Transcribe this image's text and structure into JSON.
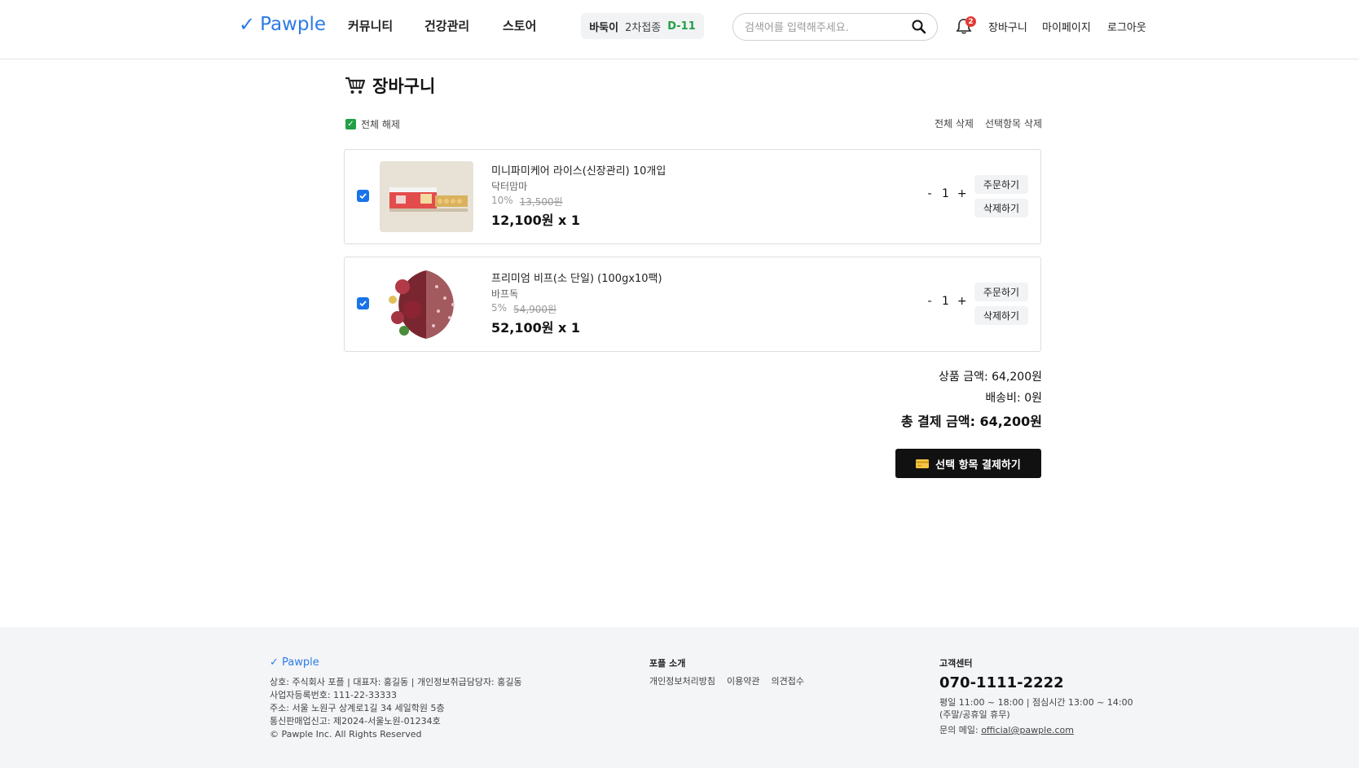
{
  "header": {
    "logo_check": "✓",
    "logo_text": "Pawple",
    "nav": [
      "커뮤니티",
      "건강관리",
      "스토어"
    ],
    "vaccine": {
      "pet_name": "바둑이",
      "label": "2차접종",
      "dday": "D-11"
    },
    "search_placeholder": "검색어를 입력해주세요.",
    "notification_count": "2",
    "links": [
      "장바구니",
      "마이페이지",
      "로그아웃"
    ]
  },
  "cart": {
    "title": "장바구니",
    "select_all_label": "전체 해제",
    "delete_all": "전체 삭제",
    "delete_selected": "선택항목 삭제",
    "items": [
      {
        "name": "미니파미케어 라이스(신장관리) 10개입",
        "brand": "닥터맘마",
        "discount": "10%",
        "original_price": "13,500원",
        "final": "12,100원 x 1",
        "quantity": "1",
        "order_label": "주문하기",
        "delete_label": "삭제하기"
      },
      {
        "name": "프리미엄 비프(소 단일) (100gx10팩)",
        "brand": "바프독",
        "discount": "5%",
        "original_price": "54,900원",
        "final": "52,100원 x 1",
        "quantity": "1",
        "order_label": "주문하기",
        "delete_label": "삭제하기"
      }
    ],
    "qty_minus": "-",
    "qty_plus": "+",
    "summary": {
      "product_amount": "상품 금액: 64,200원",
      "shipping": "배송비: 0원",
      "total": "총 결제 금액: 64,200원"
    },
    "pay_button": "선택 항목 결제하기"
  },
  "footer": {
    "logo": "✓ Pawple",
    "info": [
      "상호: 주식회사 포플 | 대표자: 홍길동 | 개인정보취급담당자: 홍길동",
      "사업자등록번호: 111-22-33333",
      "주소: 서울 노원구 상계로1길 34 세일학원 5층",
      "통신판매업신고: 제2024-서울노원-01234호",
      "© Pawple Inc. All Rights Reserved"
    ],
    "about_title": "포플 소개",
    "about_links": [
      "개인정보처리방침",
      "이용약관",
      "의견접수"
    ],
    "cs_title": "고객센터",
    "phone": "070-1111-2222",
    "hours": "평일 11:00 ~ 18:00 | 점심시간 13:00 ~ 14:00",
    "holiday": "(주말/공휴일 휴무)",
    "mail_label": "문의 메일: ",
    "mail": "official@pawple.com"
  },
  "colors": {
    "brand": "#2c7be5",
    "dday": "#22a046",
    "badge": "#e53935",
    "checkbox": "#1a73e8"
  }
}
